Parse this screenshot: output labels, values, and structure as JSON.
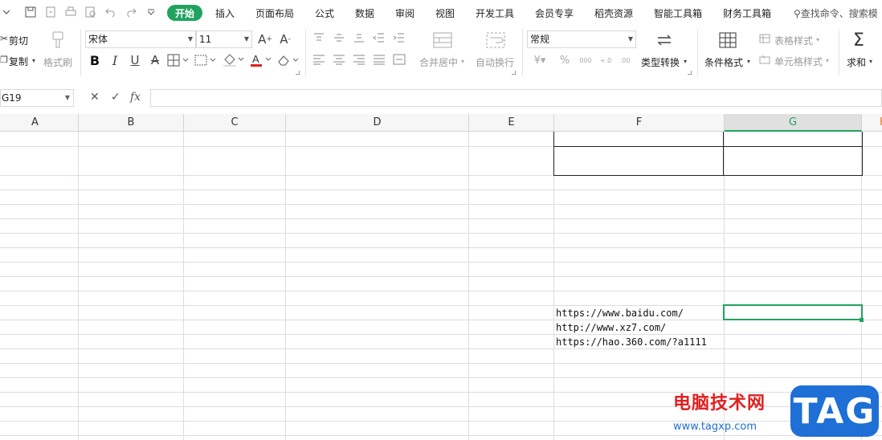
{
  "colors": {
    "accent": "#20a35f",
    "grid": "#dbdde3",
    "header_bg": "#f6f6f6",
    "watermark_red": "#e02020",
    "watermark_blue": "#1e6fd6"
  },
  "menubar": {
    "tabs": [
      "开始",
      "插入",
      "页面布局",
      "公式",
      "数据",
      "审阅",
      "视图",
      "开发工具",
      "会员专享",
      "稻壳资源",
      "智能工具箱",
      "财务工具箱"
    ],
    "active_tab": "开始",
    "search_text": "查找命令、搜索模",
    "quick_icons": [
      "save-icon",
      "export-icon",
      "print-icon",
      "preview-icon",
      "undo-icon",
      "redo-icon",
      "more-icon"
    ]
  },
  "ribbon": {
    "cut": "剪切",
    "copy": "复制",
    "format_painter": "格式刷",
    "font_name": "宋体",
    "font_size": "11",
    "bold": "B",
    "italic": "I",
    "underline": "U",
    "merge_center": "合并居中",
    "wrap_text": "自动换行",
    "number_format": "常规",
    "type_convert": "类型转换",
    "conditional_format": "条件格式",
    "table_style": "表格样式",
    "cell_style": "单元格样式",
    "sum": "求和"
  },
  "formula_bar": {
    "cell_ref": "G19",
    "fx": "fx",
    "content": ""
  },
  "grid": {
    "columns": [
      "A",
      "B",
      "C",
      "D",
      "E",
      "F",
      "G",
      "H"
    ],
    "selected_column": "G",
    "selected_cell": "G19",
    "cells": [
      {
        "ref": "F19",
        "value": "https://www.baidu.com/"
      },
      {
        "ref": "F20",
        "value": "http://www.xz7.com/"
      },
      {
        "ref": "F21",
        "value": "https://hao.360.com/?a1111"
      }
    ]
  },
  "watermark": {
    "title": "电脑技术网",
    "url": "www.tagxp.com",
    "badge": "TAG"
  }
}
